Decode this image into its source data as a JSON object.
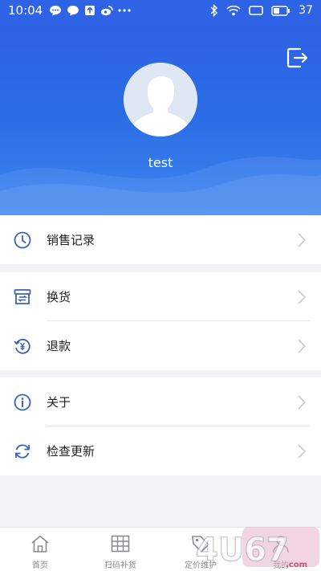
{
  "status_bar": {
    "time": "10:04",
    "battery": "37"
  },
  "profile": {
    "username": "test"
  },
  "menu": {
    "group1": [
      {
        "label": "销售记录",
        "icon": "clock-icon"
      }
    ],
    "group2": [
      {
        "label": "换货",
        "icon": "exchange-box-icon"
      },
      {
        "label": "退款",
        "icon": "refund-icon"
      }
    ],
    "group3": [
      {
        "label": "关于",
        "icon": "info-icon"
      },
      {
        "label": "检查更新",
        "icon": "refresh-icon"
      }
    ]
  },
  "tabbar": {
    "items": [
      {
        "label": "首页",
        "icon": "home-icon"
      },
      {
        "label": "扫码补货",
        "icon": "grid-icon"
      },
      {
        "label": "定价维护",
        "icon": "price-tag-icon"
      },
      {
        "label": "我的",
        "icon": "user-icon",
        "active": true
      }
    ]
  },
  "colors": {
    "primary": "#2e5fe3",
    "icon_blue": "#3a63b8",
    "tab_gray": "#8a8a90"
  },
  "watermark": {
    "text": "4U67.com"
  }
}
